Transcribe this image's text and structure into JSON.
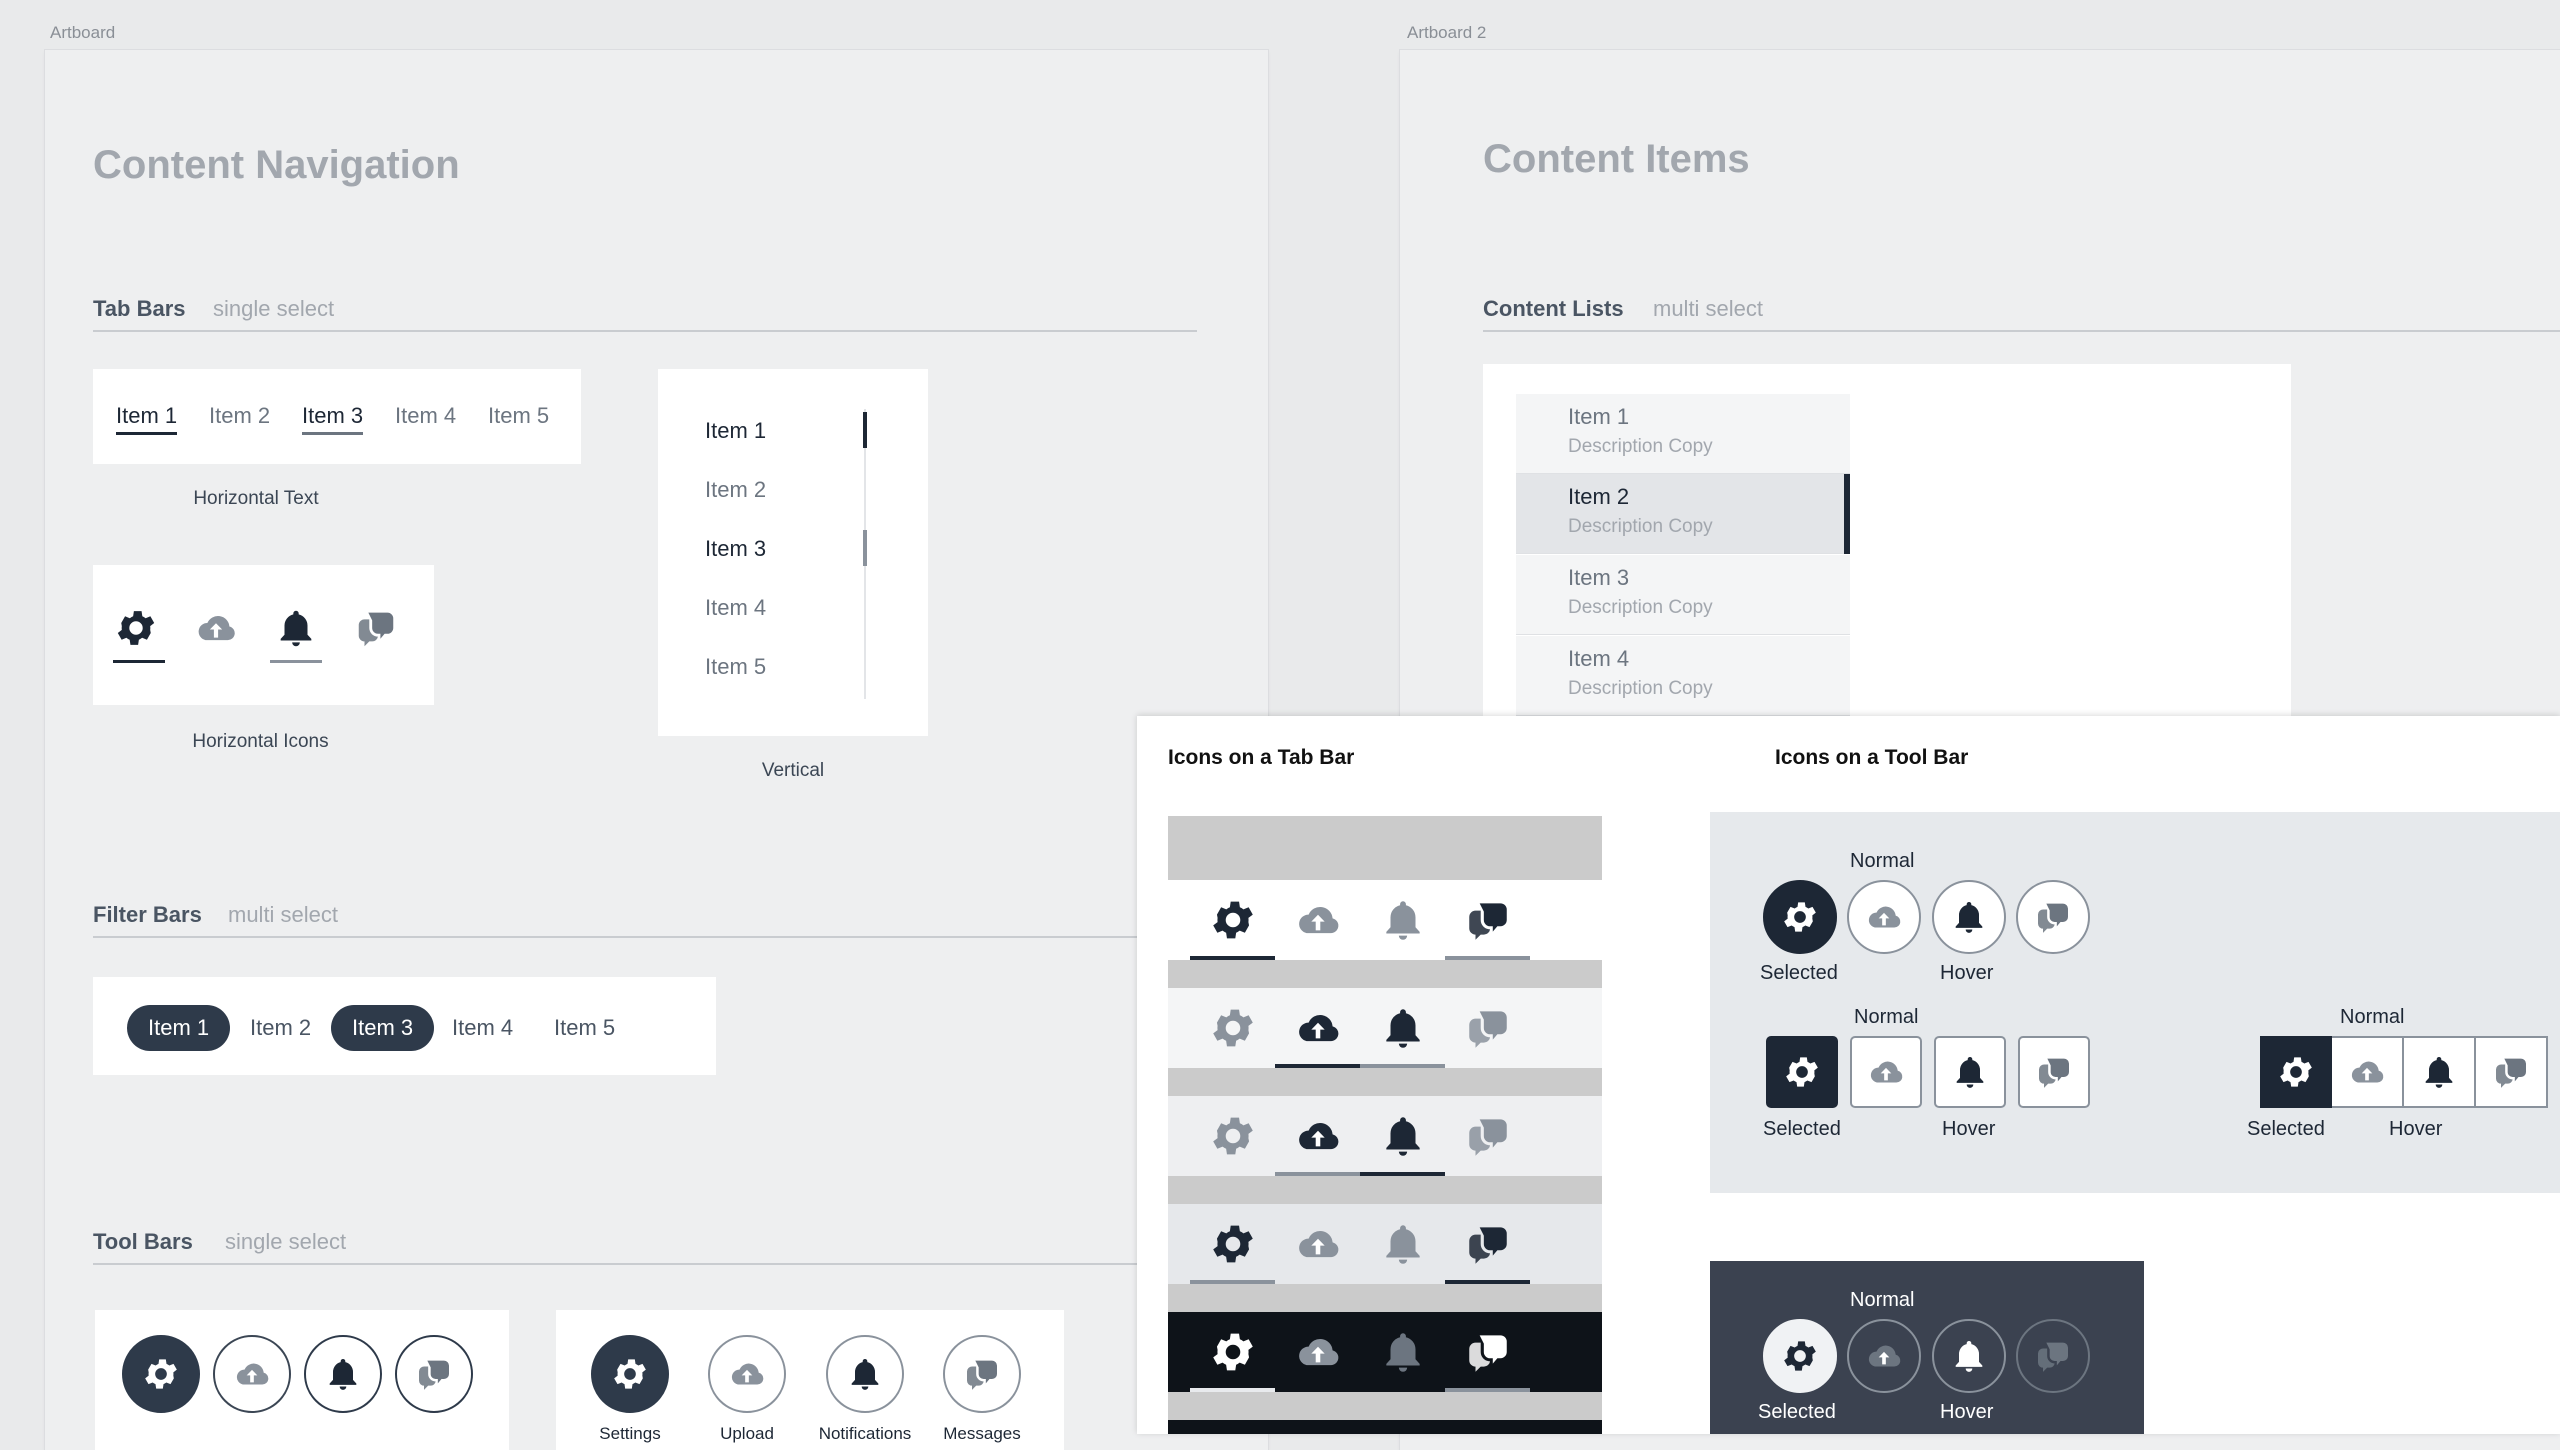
{
  "artboards": {
    "left_label": "Artboard",
    "right_label": "Artboard 2"
  },
  "left": {
    "title": "Content Navigation",
    "tab_bars": {
      "title": "Tab Bars",
      "subtitle": "single select",
      "horizontal_items": [
        "Item 1",
        "Item 2",
        "Item 3",
        "Item 4",
        "Item 5"
      ],
      "horizontal_caption": "Horizontal Text",
      "icons_caption": "Horizontal Icons",
      "vertical_items": [
        "Item 1",
        "Item 2",
        "Item 3",
        "Item 4",
        "Item 5"
      ],
      "vertical_caption": "Vertical"
    },
    "filter_bars": {
      "title": "Filter Bars",
      "subtitle": "multi select",
      "items": [
        "Item 1",
        "Item 2",
        "Item 3",
        "Item 4",
        "Item 5"
      ]
    },
    "tool_bars": {
      "title": "Tool Bars",
      "subtitle": "single select",
      "labels": [
        "Settings",
        "Upload",
        "Notifications",
        "Messages"
      ]
    }
  },
  "right": {
    "title": "Content Items",
    "content_lists": {
      "title": "Content Lists",
      "subtitle": "multi select",
      "items": [
        {
          "title": "Item 1",
          "desc": "Description Copy"
        },
        {
          "title": "Item 2",
          "desc": "Description Copy"
        },
        {
          "title": "Item 3",
          "desc": "Description Copy"
        },
        {
          "title": "Item 4",
          "desc": "Description Copy"
        }
      ]
    }
  },
  "overlay": {
    "tab_bar_title": "Icons on a Tab Bar",
    "tool_bar_title": "Icons on a Tool Bar",
    "state_labels": {
      "normal": "Normal",
      "selected": "Selected",
      "hover": "Hover"
    }
  },
  "icons": [
    "gear-icon",
    "cloud-upload-icon",
    "bell-icon",
    "chat-icon"
  ],
  "colors": {
    "dark": "#1d2735",
    "selected_fill": "#2e3a4a",
    "muted": "#6c7580",
    "panel_bg": "#e6e9ec",
    "dark_panel": "#3b4250"
  }
}
